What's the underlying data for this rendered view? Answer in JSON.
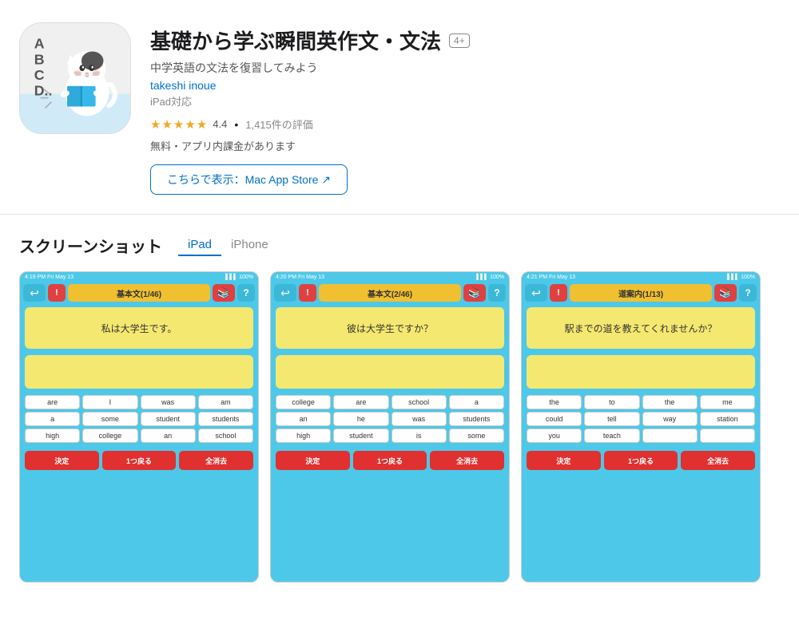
{
  "app": {
    "title": "基礎から学ぶ瞬間英作文・文法",
    "age_badge": "4+",
    "subtitle": "中学英語の文法を復習してみよう",
    "developer": "takeshi inoue",
    "ipad_compat": "iPad対応",
    "stars_display": "★★★★★",
    "rating": "4.4",
    "review_count": "1,415件の評価",
    "price": "無料・アプリ内課金があります",
    "mac_store_btn": "こちらで表示：Mac App Store ↗"
  },
  "screenshots": {
    "section_title": "スクリーンショット",
    "tabs": [
      {
        "label": "iPad",
        "active": true
      },
      {
        "label": "iPhone",
        "active": false
      }
    ],
    "screens": [
      {
        "status_left": "4:19 PM  Fri May 13",
        "status_right": "100%",
        "title": "基本文(1/46)",
        "question": "私は大学生です。",
        "words": [
          "are",
          "I",
          "was",
          "am",
          "a",
          "some",
          "student",
          "students",
          "high",
          "college",
          "an",
          "school"
        ],
        "btns": [
          "決定",
          "1つ戻る",
          "全消去"
        ]
      },
      {
        "status_left": "4:20 PM  Fri May 13",
        "status_right": "100%",
        "title": "基本文(2/46)",
        "question": "彼は大学生ですか？",
        "words": [
          "college",
          "are",
          "school",
          "a",
          "an",
          "he",
          "was",
          "students",
          "high",
          "student",
          "is",
          "some"
        ],
        "btns": [
          "決定",
          "1つ戻る",
          "全消去"
        ]
      },
      {
        "status_left": "4:21 PM  Fri May 13",
        "status_right": "100%",
        "title": "道案内(1/13)",
        "question": "駅までの道を教えてくれませんか？",
        "words": [
          "the",
          "to",
          "the",
          "me",
          "could",
          "tell",
          "way",
          "station",
          "you",
          "teach",
          "",
          ""
        ],
        "btns": [
          "決定",
          "1つ戻る",
          "全消去"
        ]
      }
    ]
  },
  "icons": {
    "back_arrow": "↩",
    "alert": "!",
    "book": "📚",
    "question": "?"
  }
}
